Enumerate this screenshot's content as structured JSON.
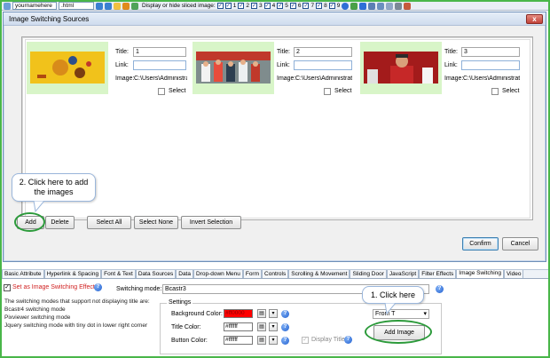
{
  "toolbar": {
    "username_value": "yournamehere",
    "ext_value": ".html",
    "sliced_label": "Display or hide sliced image:",
    "sliced_numbers": [
      "1",
      "2",
      "3",
      "4",
      "5",
      "6",
      "7",
      "8",
      "9"
    ]
  },
  "dialog": {
    "title": "Image Switching Sources",
    "close_glyph": "x",
    "labels": {
      "title": "Title:",
      "link": "Link:",
      "image": "Image:",
      "select": "Select"
    },
    "items": [
      {
        "title": "1",
        "link": "",
        "image_path": "C:\\Users\\Administrator\\Desk"
      },
      {
        "title": "2",
        "link": "",
        "image_path": "C:\\Users\\Administrator\\Desk"
      },
      {
        "title": "3",
        "link": "",
        "image_path": "C:\\Users\\Administrator\\Desk"
      }
    ],
    "buttons": {
      "add": "Add",
      "delete": "Delete",
      "select_all": "Select All",
      "select_none": "Select None",
      "invert_selection": "Invert Selection",
      "confirm": "Confirm",
      "cancel": "Cancel"
    }
  },
  "callouts": {
    "add_images": "2. Click here to add the images",
    "click_here": "1. Click here"
  },
  "tabs": [
    "Basic Attribute",
    "Hyperlink & Spacing",
    "Font & Text",
    "Data Sources",
    "Data",
    "Drop-down Menu",
    "Form",
    "Controls",
    "Scrolling & Movement",
    "Sliding Door",
    "JavaScript",
    "Filter Effects",
    "Image Switching",
    "Video"
  ],
  "props": {
    "effect_checkbox_label": "Set as Image Switching Effect",
    "switching_mode_label": "Switching mode:",
    "switching_mode_value": "Bcastr3",
    "description_lines": [
      "The switching modes that support not displaying title are:",
      "Bcastr4 switching mode",
      "Pixviewer switching mode",
      "Jquery switching mode with tiny dot in lower right corner"
    ],
    "settings_legend": "Settings",
    "background_color_label": "Background Color:",
    "background_color_value": "#ff0000",
    "title_color_label": "Title Color:",
    "title_color_value": "#ffffff",
    "button_color_label": "Button Color:",
    "button_color_value": "#ffffff",
    "display_title_label": "Display Title",
    "from_value": "From T",
    "add_image_button": "Add Image"
  },
  "colors": {
    "frame_green": "#49b649",
    "callout_ring": "#2b9a3a",
    "thumb_bg": "#d8f5c8",
    "effect_label_red": "#d02020",
    "bg_color_swatch": "#ff0000"
  }
}
